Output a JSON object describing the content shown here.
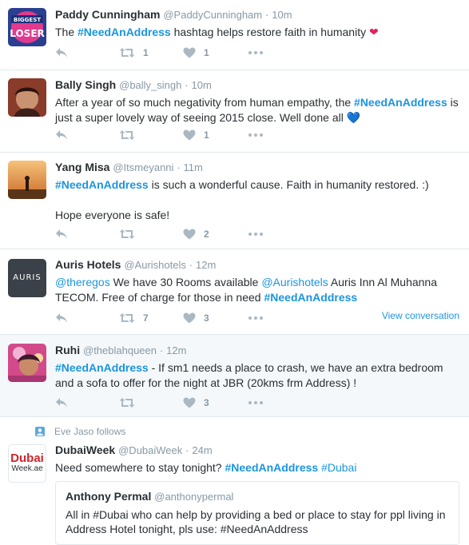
{
  "tweets": [
    {
      "name": "Paddy Cunningham",
      "handle": "@PaddyCunningham",
      "dot": "·",
      "time": "10m",
      "text_1": "The ",
      "tag_1": "#NeedAnAddress",
      "text_2": " hashtag helps restore faith in humanity ",
      "emoji": "❤",
      "retweets": "1",
      "likes": "1",
      "avatar_icon": "biggest-loser-avatar"
    },
    {
      "name": "Bally Singh",
      "handle": "@bally_singh",
      "dot": "·",
      "time": "10m",
      "text_1": "After a year of so much negativity from human empathy, the ",
      "tag_1": "#NeedAnAddress",
      "text_2": " is just a super lovely way of seeing 2015 close. Well done all ",
      "emoji": "💙",
      "retweets": "",
      "likes": "1",
      "avatar_icon": "person-avatar"
    },
    {
      "name": "Yang Misa",
      "handle": "@Itsmeyanni",
      "dot": "·",
      "time": "11m",
      "tag_1": "#NeedAnAddress",
      "text_1": " is such a wonderful cause. Faith in humanity restored. :)",
      "text_2": "Hope everyone is safe!",
      "retweets": "",
      "likes": "2",
      "avatar_icon": "sunset-avatar"
    },
    {
      "name": "Auris Hotels",
      "handle": "@Aurishotels",
      "dot": "·",
      "time": "12m",
      "mention_1": "@theregos",
      "text_1": " We have 30 Rooms available ",
      "mention_2": "@Aurishotels",
      "text_2": " Auris Inn Al Muhanna TECOM. Free of charge for those in need ",
      "tag_1": "#NeedAnAddress",
      "retweets": "7",
      "likes": "3",
      "view_conversation": "View conversation",
      "avatar_logo_text": "AURIS",
      "avatar_icon": "auris-logo-avatar"
    },
    {
      "name": "Ruhi",
      "handle": "@theblahqueen",
      "dot": "·",
      "time": "12m",
      "tag_1": "#NeedAnAddress",
      "text_1": "  - If sm1 needs a place to crash, we have an extra bedroom and a sofa to offer for the night at JBR (20kms frm Address) !",
      "retweets": "",
      "likes": "3",
      "avatar_icon": "person-avatar"
    },
    {
      "context": "Eve Jaso follows",
      "name": "DubaiWeek",
      "handle": "@DubaiWeek",
      "dot": "·",
      "time": "24m",
      "text_1": "Need somewhere to stay tonight? ",
      "tag_1": "#NeedAnAddress",
      "tag_2": "#Dubai",
      "avatar_logo_text": "Dubai",
      "avatar_logo_sub": "Week.ae",
      "avatar_icon": "dubaiweek-logo-avatar",
      "quote": {
        "name": "Anthony Permal",
        "handle": "@anthonypermal",
        "text": "All in #Dubai who can help by providing a bed or place to stay for ppl living in Address Hotel tonight, pls use: #NeedAnAddress"
      }
    }
  ],
  "colors": {
    "link": "#1b95e0",
    "muted": "#8899a6",
    "icon": "#aab8c2",
    "text": "#292f33",
    "highlight_bg": "#f5f8fa"
  }
}
